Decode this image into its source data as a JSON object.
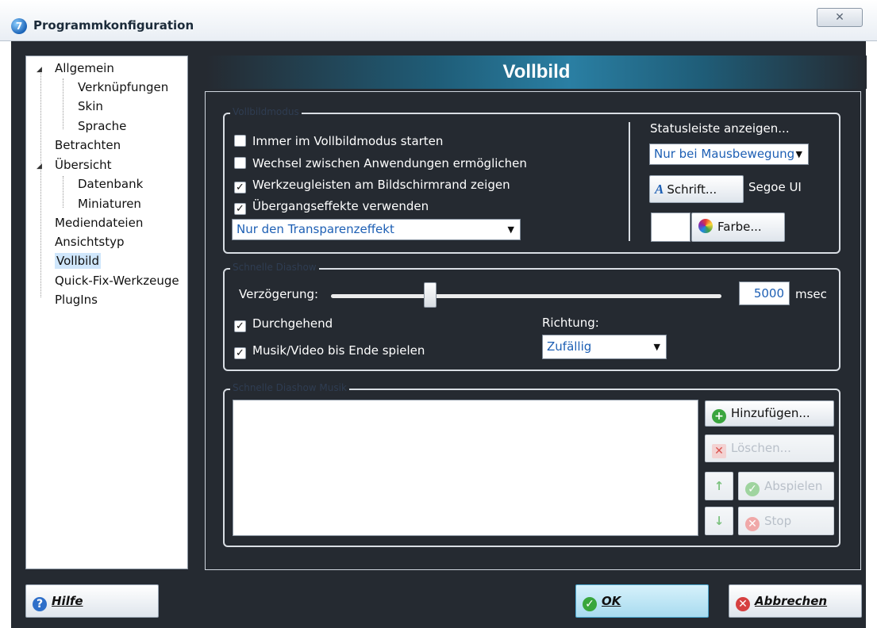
{
  "window": {
    "title": "Programmkonfiguration",
    "close_glyph": "✕",
    "icon": "app-icon"
  },
  "tree": {
    "items": [
      {
        "label": "Allgemein",
        "level": 0,
        "expanded": true
      },
      {
        "label": "Verknüpfungen",
        "level": 1
      },
      {
        "label": "Skin",
        "level": 1
      },
      {
        "label": "Sprache",
        "level": 1
      },
      {
        "label": "Betrachten",
        "level": 0
      },
      {
        "label": "Übersicht",
        "level": 0,
        "expanded": true
      },
      {
        "label": "Datenbank",
        "level": 1
      },
      {
        "label": "Miniaturen",
        "level": 1
      },
      {
        "label": "Mediendateien",
        "level": 0
      },
      {
        "label": "Ansichtstyp",
        "level": 0
      },
      {
        "label": "Vollbild",
        "level": 0,
        "selected": true
      },
      {
        "label": "Quick-Fix-Werkzeuge",
        "level": 0
      },
      {
        "label": "PlugIns",
        "level": 0
      }
    ]
  },
  "page": {
    "title": "Vollbild"
  },
  "vollbildmodus": {
    "group_label": "Vollbildmodus",
    "checkboxes": [
      {
        "label": "Immer im Vollbildmodus starten",
        "checked": false
      },
      {
        "label": "Wechsel zwischen Anwendungen ermöglichen",
        "checked": false
      },
      {
        "label": "Werkzeugleisten am Bildschirmrand zeigen",
        "checked": true
      },
      {
        "label": "Übergangseffekte verwenden",
        "checked": true
      }
    ],
    "effect_select": "Nur den Transparenzeffekt",
    "status_label": "Statusleiste anzeigen...",
    "status_select": "Nur bei Mausbewegung",
    "font_button": "Schrift...",
    "font_name": "Segoe UI",
    "color_button": "Farbe...",
    "color_value": "#ffffff"
  },
  "diashow": {
    "group_label": "Schnelle Diashow",
    "delay_label": "Verzögerung:",
    "delay_value": "5000",
    "delay_unit": "msec",
    "delay_slider_fraction": 0.25,
    "checkboxes": [
      {
        "label": "Durchgehend",
        "checked": true
      },
      {
        "label": "Musik/Video bis Ende spielen",
        "checked": true
      }
    ],
    "direction_label": "Richtung:",
    "direction_select": "Zufällig"
  },
  "music": {
    "group_label": "Schnelle Diashow Musik",
    "add_button": "Hinzufügen...",
    "delete_button": "Löschen...",
    "play_button": "Abspielen",
    "stop_button": "Stop"
  },
  "footer": {
    "help": "Hilfe",
    "ok": "OK",
    "cancel": "Abbrechen"
  },
  "colors": {
    "accent": "#2a7fa3",
    "panel": "#252a31",
    "selection": "#cfe6fb"
  }
}
